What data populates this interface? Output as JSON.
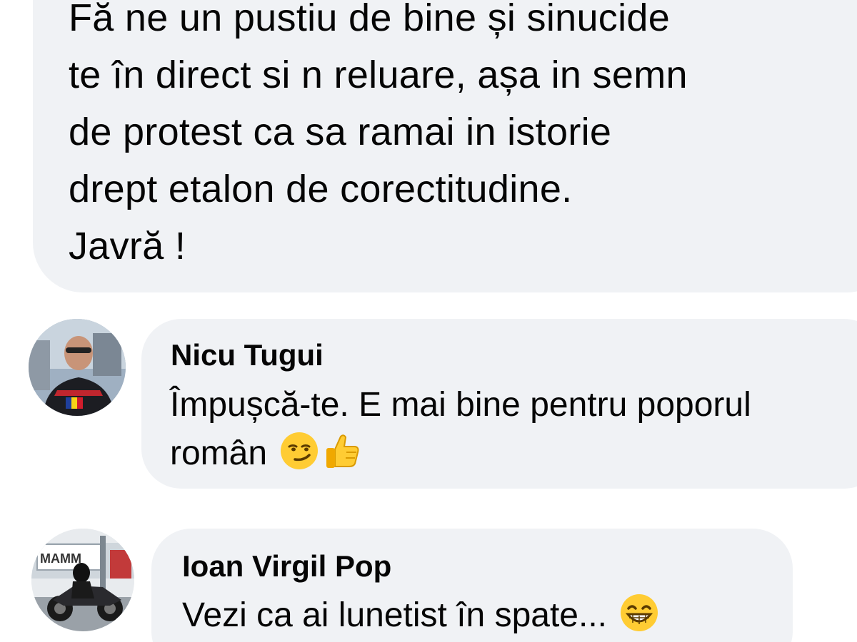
{
  "post_comment": {
    "text": "Fă ne un pustiu de bine și sinucide\nte în direct si n reluare, așa in semn\nde protest ca sa ramai in istorie\ndrept etalon de corectitudine.\nJavră !"
  },
  "replies": [
    {
      "author": "Nicu Tugui",
      "text_line1": "Împușcă-te. E mai bine pentru poporul",
      "text_line2": "român",
      "emojis": [
        "smirking-face-emoji",
        "thumbs-up-emoji"
      ]
    },
    {
      "author": "Ioan Virgil Pop",
      "text": "Vezi ca ai lunetist în spate...",
      "emojis": [
        "grinning-face-emoji"
      ],
      "avatar_sign_text": "MAMM"
    }
  ],
  "colors": {
    "bubble_background": "#f0f2f5",
    "text": "#050505",
    "page_background": "#ffffff"
  }
}
